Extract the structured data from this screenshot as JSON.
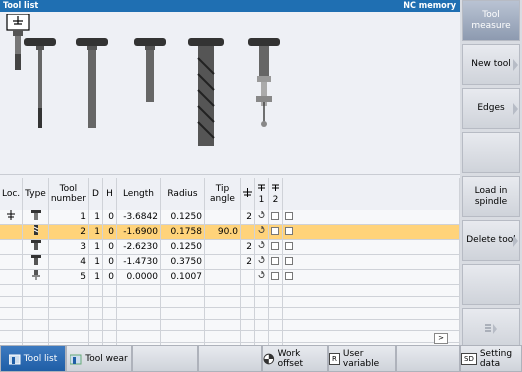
{
  "titlebar": {
    "title": "Tool list",
    "memory": "NC memory"
  },
  "table": {
    "headers": {
      "loc": "Loc.",
      "type": "Type",
      "tool_number": "Tool number",
      "d": "D",
      "h": "H",
      "length": "Length",
      "radius": "Radius",
      "tip_angle": "Tip angle",
      "col1": "1",
      "col2": "2"
    },
    "rows": [
      {
        "loc_icon": "spindle-icon",
        "type_icon": "face-mill-icon",
        "tool_number": "1",
        "d": "1",
        "h": "0",
        "length": "-3.6842",
        "radius": "0.1250",
        "tip_angle": "",
        "dir": "2"
      },
      {
        "loc_icon": "",
        "type_icon": "drill-icon",
        "tool_number": "2",
        "d": "1",
        "h": "0",
        "length": "-1.6900",
        "radius": "0.1758",
        "tip_angle": "90.0",
        "dir": ""
      },
      {
        "loc_icon": "",
        "type_icon": "end-mill-icon",
        "tool_number": "3",
        "d": "1",
        "h": "0",
        "length": "-2.6230",
        "radius": "0.1250",
        "tip_angle": "",
        "dir": "2"
      },
      {
        "loc_icon": "",
        "type_icon": "end-mill-icon",
        "tool_number": "4",
        "d": "1",
        "h": "0",
        "length": "-1.4730",
        "radius": "0.3750",
        "tip_angle": "",
        "dir": "2"
      },
      {
        "loc_icon": "",
        "type_icon": "probe-icon",
        "tool_number": "5",
        "d": "1",
        "h": "0",
        "length": "0.0000",
        "radius": "0.1007",
        "tip_angle": "",
        "dir": ""
      }
    ],
    "selected_row": 1
  },
  "softkeys_right": {
    "tool_measure": "Tool measure",
    "new_tool": "New tool",
    "edges": "Edges",
    "load_in_spindle": "Load in spindle",
    "delete_tool": "Delete tool"
  },
  "softkeys_bottom": {
    "tool_list": "Tool list",
    "tool_wear": "Tool wear",
    "work_offset": "Work offset",
    "user_variable": "User variable",
    "user_variable_badge": "R",
    "setting_data": "Setting data",
    "setting_data_badge": "SD"
  },
  "colors": {
    "title_bar": "#1f6fb2",
    "selected_row": "#ffd37a",
    "active_softkey": "#2a68b0"
  }
}
